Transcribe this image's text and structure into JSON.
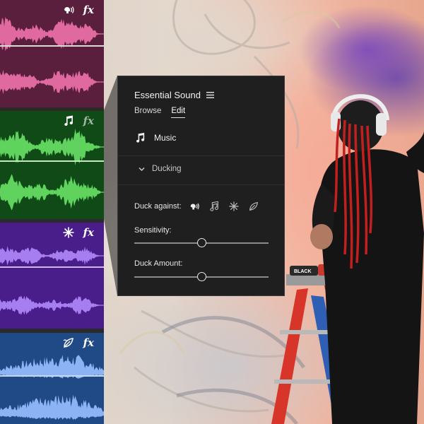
{
  "panel": {
    "title": "Essential Sound",
    "tabs": [
      {
        "label": "Browse",
        "active": false
      },
      {
        "label": "Edit",
        "active": true
      }
    ],
    "type_label": "Music",
    "section_label": "Ducking",
    "duck_against_label": "Duck against:",
    "duck_against_icons": [
      "dialogue-icon",
      "music-icon",
      "sfx-icon",
      "ambience-icon"
    ],
    "sensitivity_label": "Sensitivity:",
    "sensitivity_value": 0.5,
    "duck_amount_label": "Duck Amount:",
    "duck_amount_value": 0.5
  },
  "tracks": [
    {
      "type": "dialogue",
      "icon": "dialogue-icon",
      "fx_label": "fx",
      "color": "#5a1f3c",
      "wave_color": "#e06aa0"
    },
    {
      "type": "music",
      "icon": "music-icon",
      "fx_label": "fx",
      "color": "#0f4a17",
      "wave_color": "#5fd35d"
    },
    {
      "type": "sfx",
      "icon": "sfx-icon",
      "fx_label": "fx",
      "color": "#4a1e8a",
      "wave_color": "#a77ef0"
    },
    {
      "type": "ambience",
      "icon": "ambience-icon",
      "fx_label": "fx",
      "color": "#1f4a85",
      "wave_color": "#8cb3f4"
    }
  ],
  "scene": {
    "can_label": "BLACK"
  },
  "colors": {
    "panel_bg": "#1f1f1f",
    "accent_text": "#ffffff"
  }
}
